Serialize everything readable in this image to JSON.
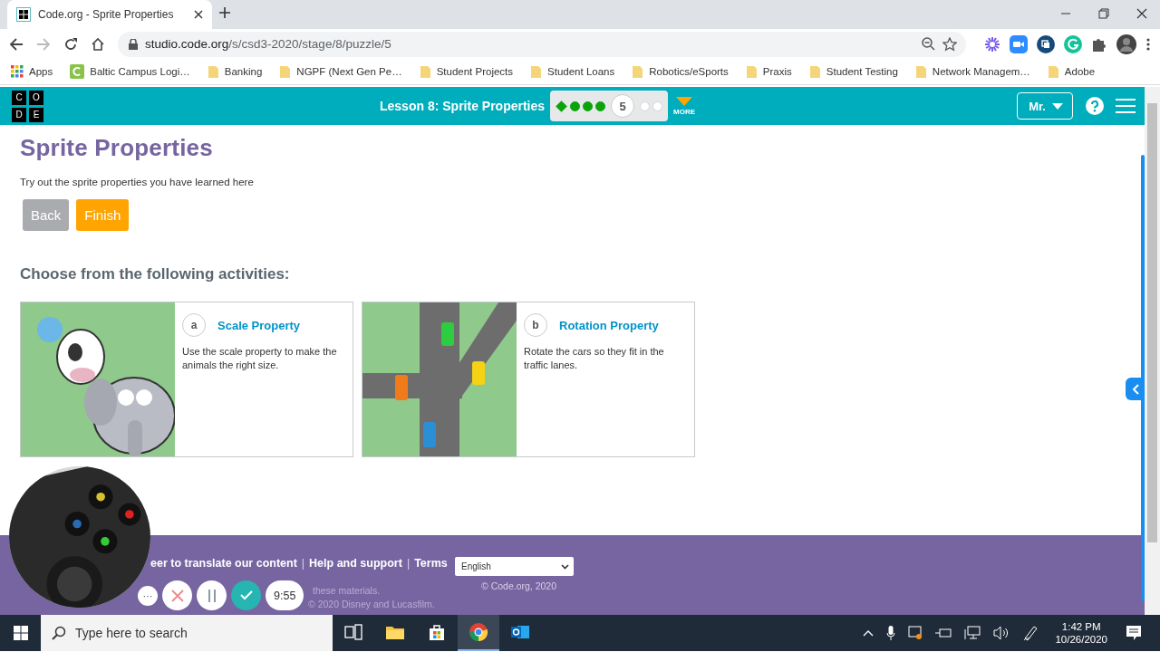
{
  "browser": {
    "tab": {
      "title": "Code.org - Sprite Properties",
      "selected": true
    },
    "url": {
      "host": "studio.code.org",
      "path": "/s/csd3-2020/stage/8/puzzle/5"
    },
    "bookmarks": [
      {
        "kind": "apps",
        "label": "Apps"
      },
      {
        "kind": "site",
        "label": "Baltic Campus Logi…"
      },
      {
        "kind": "folder",
        "label": "Banking"
      },
      {
        "kind": "folder",
        "label": "NGPF (Next Gen Pe…"
      },
      {
        "kind": "folder",
        "label": "Student Projects"
      },
      {
        "kind": "folder",
        "label": "Student Loans"
      },
      {
        "kind": "folder",
        "label": "Robotics/eSports"
      },
      {
        "kind": "folder",
        "label": "Praxis"
      },
      {
        "kind": "folder",
        "label": "Student Testing"
      },
      {
        "kind": "folder",
        "label": "Network Managem…"
      },
      {
        "kind": "folder",
        "label": "Adobe"
      }
    ]
  },
  "header": {
    "logo_letters": [
      "C",
      "O",
      "D",
      "E"
    ],
    "lesson_title": "Lesson 8: Sprite Properties",
    "progress": [
      {
        "kind": "diamond",
        "completed": true
      },
      {
        "kind": "dot",
        "completed": true
      },
      {
        "kind": "dot",
        "completed": true
      },
      {
        "kind": "dot",
        "completed": true
      },
      {
        "kind": "current",
        "label": "5",
        "completed": false
      },
      {
        "kind": "dot",
        "completed": false
      },
      {
        "kind": "dot",
        "completed": false
      }
    ],
    "more_label": "MORE",
    "user_button": "Mr."
  },
  "content": {
    "title": "Sprite Properties",
    "subtitle": "Try out the sprite properties you have learned here",
    "buttons": [
      {
        "label": "Back",
        "disabled": true
      },
      {
        "label": "Finish",
        "disabled": false
      }
    ],
    "section_heading": "Choose from the following activities:",
    "activities": [
      {
        "kind": "animals",
        "letter": "a",
        "title": "Scale Property",
        "description": "Use the scale property to make the animals the right size."
      },
      {
        "kind": "roads",
        "letter": "b",
        "title": "Rotation Property",
        "description": "Rotate the cars so they fit in the traffic lanes."
      }
    ]
  },
  "footer": {
    "links": [
      {
        "kind": "link",
        "label": "eer to translate our content"
      },
      {
        "kind": "separator",
        "label": "|"
      },
      {
        "kind": "link",
        "label": "Help and support"
      },
      {
        "kind": "separator",
        "label": "|"
      },
      {
        "kind": "link",
        "label": "Terms"
      }
    ],
    "language": "English",
    "copyright": "© Code.org, 2020",
    "legal_lines": [
      "these materials.",
      "© 2020 Disney and Lucasfilm."
    ]
  },
  "recorder": {
    "more": "···",
    "timer": "9:55"
  },
  "taskbar": {
    "search_placeholder": "Type here to search",
    "apps": [
      {
        "kind": "task-view",
        "selected": false
      },
      {
        "kind": "explorer",
        "selected": false
      },
      {
        "kind": "store",
        "selected": false
      },
      {
        "kind": "chrome",
        "selected": true
      },
      {
        "kind": "outlook",
        "selected": false
      }
    ],
    "time": "1:42 PM",
    "date": "10/26/2020"
  }
}
